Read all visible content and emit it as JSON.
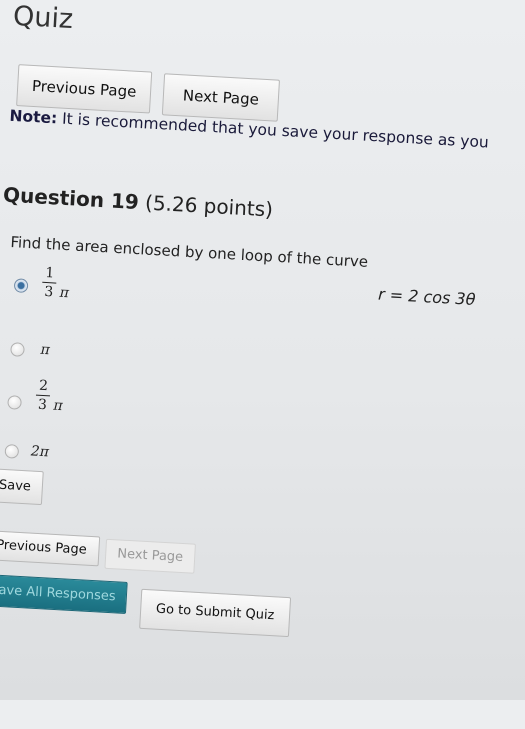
{
  "page": {
    "title": "Quiz"
  },
  "nav_top": {
    "previous_label": "Previous Page",
    "next_label": "Next Page"
  },
  "note": {
    "label": "Note:",
    "text": " It is recommended that you save your response as you"
  },
  "question": {
    "heading": "Question 19",
    "points": " (5.26 points)",
    "text": "Find the area enclosed by one loop of the curve",
    "curve": "r = 2 cos 3θ",
    "options": [
      {
        "num": "1",
        "den": "3",
        "sym": "π",
        "selected": true
      },
      {
        "sym": "π",
        "selected": false
      },
      {
        "num": "2",
        "den": "3",
        "sym": "π",
        "selected": false
      },
      {
        "sym": "2π",
        "selected": false
      }
    ]
  },
  "actions": {
    "save_label": "Save",
    "previous_label": "Previous Page",
    "next_label": "Next Page",
    "save_all_label": "Save All Responses",
    "submit_label": "Go to Submit Quiz"
  },
  "colors": {
    "save_all_bg": "#1a7a8a",
    "radio_selected": "#3a6fa0"
  }
}
